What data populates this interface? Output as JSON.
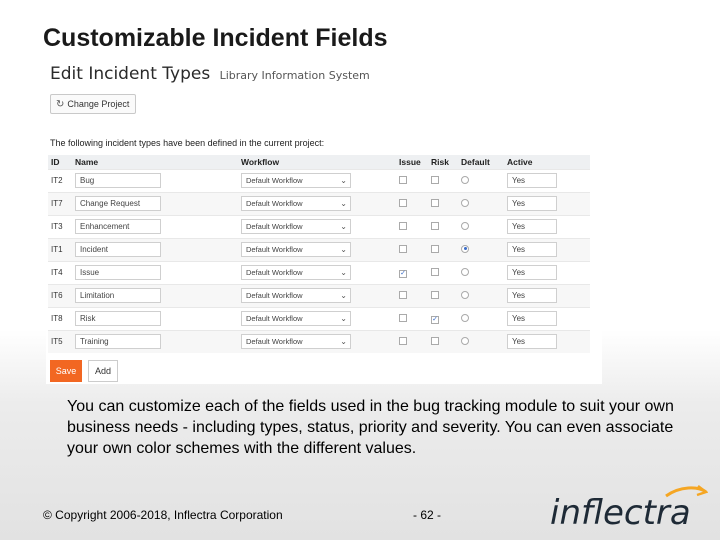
{
  "slide": {
    "title": "Customizable Incident Fields",
    "body": "You can customize each of the fields used in the bug tracking module to suit your own business needs - including types, status, priority and severity. You can even associate your own color schemes with the different values.",
    "copyright": "© Copyright 2006-2018, Inflectra Corporation",
    "page_number": "- 62 -",
    "logo_text": "inflectra"
  },
  "screenshot": {
    "heading": "Edit Incident Types",
    "project": "Library Information System",
    "change_project_label": "Change Project",
    "intro": "The following incident types have been defined in the current project:",
    "columns": [
      "ID",
      "Name",
      "Workflow",
      "Issue",
      "Risk",
      "Default",
      "Active"
    ],
    "rows": [
      {
        "id": "IT2",
        "name": "Bug",
        "workflow": "Default Workflow",
        "issue": false,
        "risk": false,
        "default": false,
        "active": "Yes"
      },
      {
        "id": "IT7",
        "name": "Change Request",
        "workflow": "Default Workflow",
        "issue": false,
        "risk": false,
        "default": false,
        "active": "Yes"
      },
      {
        "id": "IT3",
        "name": "Enhancement",
        "workflow": "Default Workflow",
        "issue": false,
        "risk": false,
        "default": false,
        "active": "Yes"
      },
      {
        "id": "IT1",
        "name": "Incident",
        "workflow": "Default Workflow",
        "issue": false,
        "risk": false,
        "default": true,
        "active": "Yes"
      },
      {
        "id": "IT4",
        "name": "Issue",
        "workflow": "Default Workflow",
        "issue": true,
        "risk": false,
        "default": false,
        "active": "Yes"
      },
      {
        "id": "IT6",
        "name": "Limitation",
        "workflow": "Default Workflow",
        "issue": false,
        "risk": false,
        "default": false,
        "active": "Yes"
      },
      {
        "id": "IT8",
        "name": "Risk",
        "workflow": "Default Workflow",
        "issue": false,
        "risk": true,
        "default": false,
        "active": "Yes"
      },
      {
        "id": "IT5",
        "name": "Training",
        "workflow": "Default Workflow",
        "issue": false,
        "risk": false,
        "default": false,
        "active": "Yes"
      }
    ],
    "save_label": "Save",
    "add_label": "Add"
  },
  "colors": {
    "accent": "#f26722",
    "logo_text": "#1e2a36",
    "logo_swoosh": "#f5a623"
  },
  "icons": {
    "change_project": "refresh-icon",
    "workflow_dropdown": "chevron-down-icon"
  }
}
